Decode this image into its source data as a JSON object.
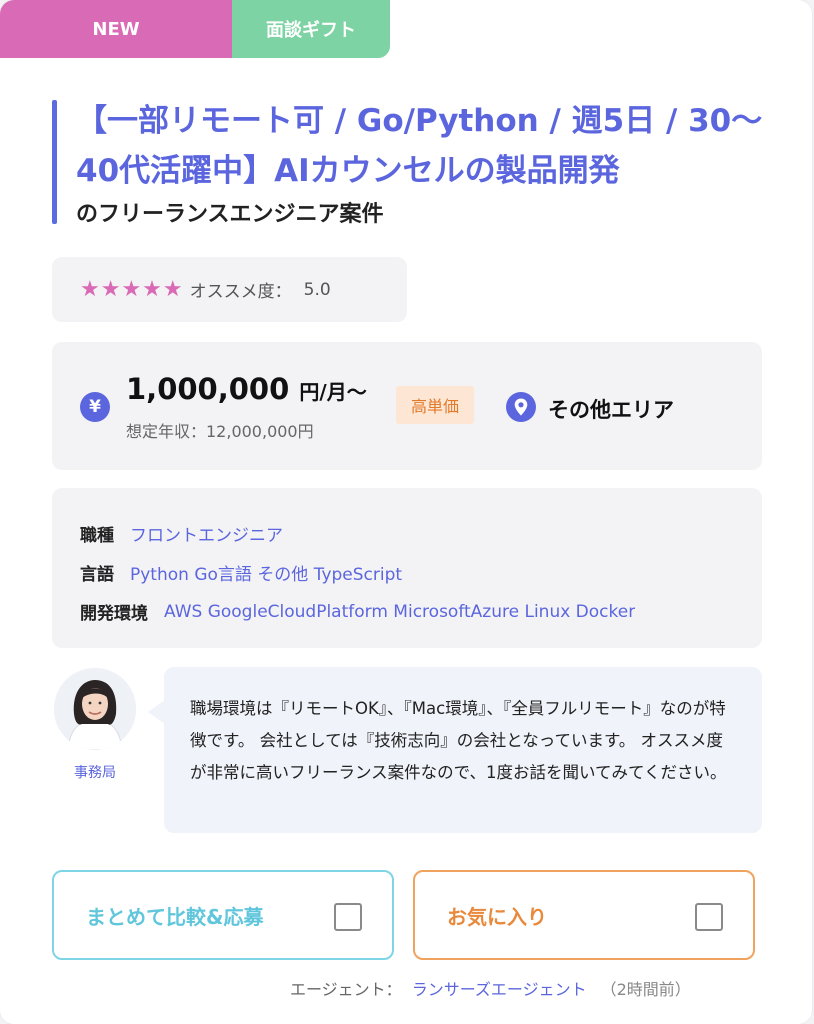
{
  "badges": {
    "new": "NEW",
    "gift": "面談ギフト"
  },
  "title": {
    "main": "【一部リモート可 / Go/Python / 週5日 / 30〜40代活躍中】AIカウンセルの製品開発",
    "sub": "のフリーランスエンジニア案件"
  },
  "rating": {
    "stars": "★★★★★",
    "label": "オススメ度：",
    "value": "5.0",
    "score": 5,
    "max": 5
  },
  "price": {
    "yen_symbol": "¥",
    "amount": "1,000,000",
    "unit": "円/月〜",
    "annual": "想定年収：12,000,000円",
    "badge": "高単価"
  },
  "location": {
    "area": "その他エリア"
  },
  "skills": [
    {
      "key": "職種",
      "value": "フロントエンジニア"
    },
    {
      "key": "言語",
      "value": "Python Go言語 その他 TypeScript"
    },
    {
      "key": "開発環境",
      "value": "AWS GoogleCloudPlatform MicrosoftAzure Linux Docker"
    }
  ],
  "agent": {
    "label": "事務局",
    "message": "職場環境は『リモートOK』、『Mac環境』、『全員フルリモート』なのが特徴です。 会社としては『技術志向』の会社となっています。 オススメ度が非常に高いフリーランス案件なので、1度お話を聞いてみてください。"
  },
  "buttons": {
    "compare": "まとめて比較&応募",
    "favorite": "お気に入り"
  },
  "footer": {
    "agent_label": "エージェント：",
    "agent_name": "ランサーズエージェント",
    "time": "（2時間前）"
  },
  "colors": {
    "accent": "#5b66de",
    "pink": "#d96bb6",
    "green": "#7dd3a3",
    "orange": "#e8893c",
    "cyan": "#5fc6dc"
  }
}
